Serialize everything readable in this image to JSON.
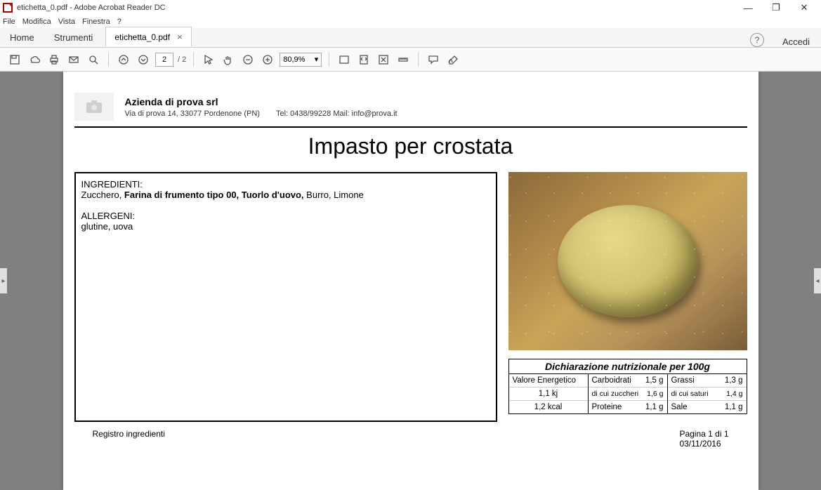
{
  "window": {
    "title": "etichetta_0.pdf - Adobe Acrobat Reader DC"
  },
  "menu": {
    "file": "File",
    "modifica": "Modifica",
    "vista": "Vista",
    "finestra": "Finestra",
    "help": "?"
  },
  "tabs": {
    "home": "Home",
    "tools": "Strumenti",
    "doc": "etichetta_0.pdf",
    "accedi": "Accedi"
  },
  "toolbar": {
    "page_current": "2",
    "page_total": "/ 2",
    "zoom": "80,9%"
  },
  "company": {
    "name": "Azienda di prova srl",
    "address": "Via di prova 14, 33077 Pordenone (PN)",
    "phone": "Tel: 0438/99228 Mail: info@prova.it"
  },
  "doc": {
    "title": "Impasto per crostata",
    "ingredients_label": "INGREDIENTI:",
    "ingredients_pre": "Zucchero, ",
    "ingredients_bold": "Farina di frumento tipo 00, Tuorlo d'uovo,",
    "ingredients_post": " Burro, Limone",
    "allergens_label": "ALLERGENI:",
    "allergens": "glutine, uova"
  },
  "nutrition": {
    "header": "Dichiarazione nutrizionale per 100g",
    "col1": [
      {
        "l": "Valore Energetico",
        "v": ""
      },
      {
        "l": "",
        "v": "1,1 kj"
      },
      {
        "l": "",
        "v": "1,2 kcal"
      }
    ],
    "col2": [
      {
        "l": "Carboidrati",
        "v": "1,5 g"
      },
      {
        "l": "di cui zuccheri",
        "v": "1,6 g",
        "small": true
      },
      {
        "l": "Proteine",
        "v": "1,1 g"
      }
    ],
    "col3": [
      {
        "l": "Grassi",
        "v": "1,3 g"
      },
      {
        "l": "di cui saturi",
        "v": "1,4 g",
        "small": true
      },
      {
        "l": "Sale",
        "v": "1,1 g"
      }
    ]
  },
  "footer": {
    "left": "Registro ingredienti",
    "page": "Pagina 1 di 1",
    "date": "03/11/2016"
  }
}
